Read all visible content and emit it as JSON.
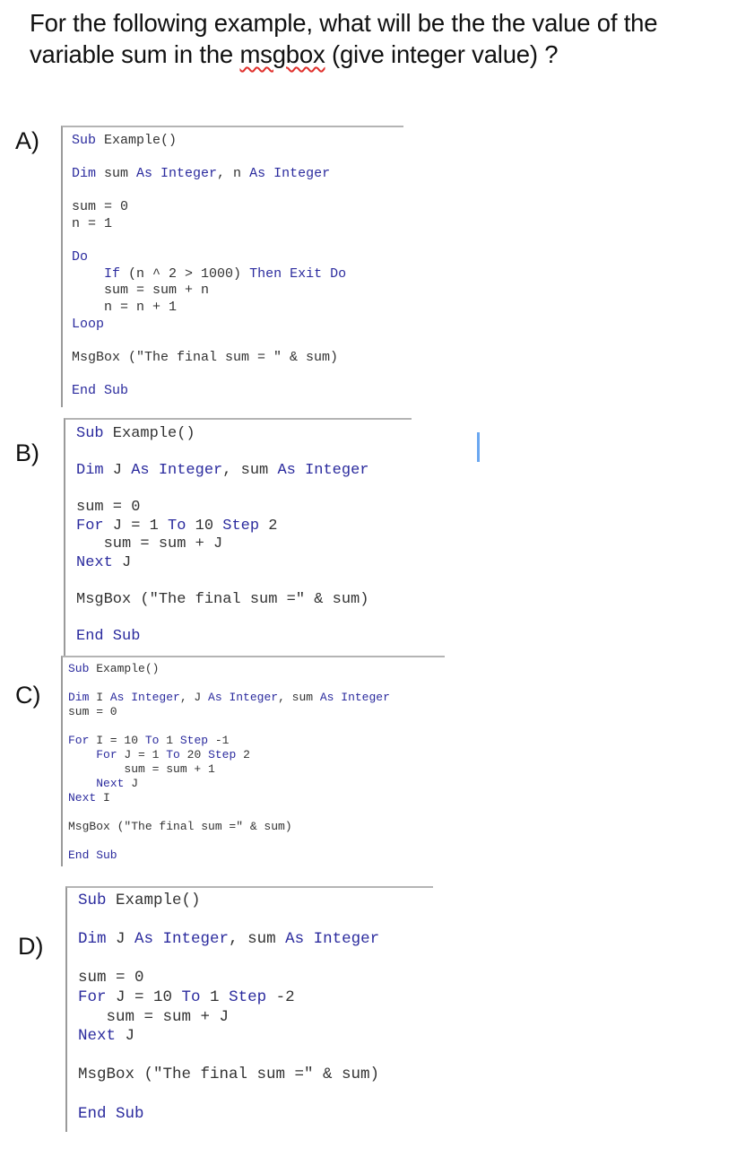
{
  "question": {
    "before": "For the following example, what will be the the value of the variable sum in the ",
    "misspelled": "msgbox",
    "after": " (give integer value) ?"
  },
  "options": [
    {
      "label": "A)",
      "lines": [
        [
          {
            "t": "Sub",
            "k": 1
          },
          {
            "t": " Example()"
          }
        ],
        [
          {
            "t": ""
          }
        ],
        [
          {
            "t": "Dim",
            "k": 1
          },
          {
            "t": " sum "
          },
          {
            "t": "As Integer",
            "k": 1
          },
          {
            "t": ", n "
          },
          {
            "t": "As Integer",
            "k": 1
          }
        ],
        [
          {
            "t": ""
          }
        ],
        [
          {
            "t": "sum = 0"
          }
        ],
        [
          {
            "t": "n = 1"
          }
        ],
        [
          {
            "t": ""
          }
        ],
        [
          {
            "t": "Do",
            "k": 1
          }
        ],
        [
          {
            "t": "    "
          },
          {
            "t": "If",
            "k": 1
          },
          {
            "t": " (n ^ 2 > 1000) "
          },
          {
            "t": "Then Exit Do",
            "k": 1
          }
        ],
        [
          {
            "t": "    sum = sum + n"
          }
        ],
        [
          {
            "t": "    n = n + 1"
          }
        ],
        [
          {
            "t": "Loop",
            "k": 1
          }
        ],
        [
          {
            "t": ""
          }
        ],
        [
          {
            "t": "MsgBox (\"The final sum = \" & sum)"
          }
        ],
        [
          {
            "t": ""
          }
        ],
        [
          {
            "t": "End Sub",
            "k": 1
          }
        ]
      ]
    },
    {
      "label": "B)",
      "lines": [
        [
          {
            "t": "Sub",
            "k": 1
          },
          {
            "t": " Example()"
          }
        ],
        [
          {
            "t": ""
          }
        ],
        [
          {
            "t": "Dim",
            "k": 1
          },
          {
            "t": " J "
          },
          {
            "t": "As Integer",
            "k": 1
          },
          {
            "t": ", sum "
          },
          {
            "t": "As Integer",
            "k": 1
          }
        ],
        [
          {
            "t": ""
          }
        ],
        [
          {
            "t": "sum = 0"
          }
        ],
        [
          {
            "t": "For",
            "k": 1
          },
          {
            "t": " J = 1 "
          },
          {
            "t": "To",
            "k": 1
          },
          {
            "t": " 10 "
          },
          {
            "t": "Step",
            "k": 1
          },
          {
            "t": " 2"
          }
        ],
        [
          {
            "t": "   sum = sum + J"
          }
        ],
        [
          {
            "t": "Next",
            "k": 1
          },
          {
            "t": " J"
          }
        ],
        [
          {
            "t": ""
          }
        ],
        [
          {
            "t": "MsgBox (\"The final sum =\" & sum)"
          }
        ],
        [
          {
            "t": ""
          }
        ],
        [
          {
            "t": "End Sub",
            "k": 1
          }
        ]
      ]
    },
    {
      "label": "C)",
      "lines": [
        [
          {
            "t": "Sub",
            "k": 1
          },
          {
            "t": " Example()"
          }
        ],
        [
          {
            "t": ""
          }
        ],
        [
          {
            "t": "Dim",
            "k": 1
          },
          {
            "t": " I "
          },
          {
            "t": "As Integer",
            "k": 1
          },
          {
            "t": ", J "
          },
          {
            "t": "As Integer",
            "k": 1
          },
          {
            "t": ", sum "
          },
          {
            "t": "As Integer",
            "k": 1
          }
        ],
        [
          {
            "t": "sum = 0"
          }
        ],
        [
          {
            "t": ""
          }
        ],
        [
          {
            "t": "For",
            "k": 1
          },
          {
            "t": " I = 10 "
          },
          {
            "t": "To",
            "k": 1
          },
          {
            "t": " 1 "
          },
          {
            "t": "Step",
            "k": 1
          },
          {
            "t": " -1"
          }
        ],
        [
          {
            "t": "    "
          },
          {
            "t": "For",
            "k": 1
          },
          {
            "t": " J = 1 "
          },
          {
            "t": "To",
            "k": 1
          },
          {
            "t": " 20 "
          },
          {
            "t": "Step",
            "k": 1
          },
          {
            "t": " 2"
          }
        ],
        [
          {
            "t": "        sum = sum + 1"
          }
        ],
        [
          {
            "t": "    "
          },
          {
            "t": "Next",
            "k": 1
          },
          {
            "t": " J"
          }
        ],
        [
          {
            "t": "Next",
            "k": 1
          },
          {
            "t": " I"
          }
        ],
        [
          {
            "t": ""
          }
        ],
        [
          {
            "t": "MsgBox (\"The final sum =\" & sum)"
          }
        ],
        [
          {
            "t": ""
          }
        ],
        [
          {
            "t": "End Sub",
            "k": 1
          }
        ]
      ]
    },
    {
      "label": "D)",
      "lines": [
        [
          {
            "t": "Sub",
            "k": 1
          },
          {
            "t": " Example()"
          }
        ],
        [
          {
            "t": ""
          }
        ],
        [
          {
            "t": "Dim",
            "k": 1
          },
          {
            "t": " J "
          },
          {
            "t": "As Integer",
            "k": 1
          },
          {
            "t": ", sum "
          },
          {
            "t": "As Integer",
            "k": 1
          }
        ],
        [
          {
            "t": ""
          }
        ],
        [
          {
            "t": "sum = 0"
          }
        ],
        [
          {
            "t": "For",
            "k": 1
          },
          {
            "t": " J = 10 "
          },
          {
            "t": "To",
            "k": 1
          },
          {
            "t": " 1 "
          },
          {
            "t": "Step",
            "k": 1
          },
          {
            "t": " -2"
          }
        ],
        [
          {
            "t": "   sum = sum + J"
          }
        ],
        [
          {
            "t": "Next",
            "k": 1
          },
          {
            "t": " J"
          }
        ],
        [
          {
            "t": ""
          }
        ],
        [
          {
            "t": "MsgBox (\"The final sum =\" & sum)"
          }
        ],
        [
          {
            "t": ""
          }
        ],
        [
          {
            "t": "End Sub",
            "k": 1
          }
        ]
      ]
    }
  ],
  "colors": {
    "keyword": "#2b2b9e",
    "code_text": "#333333",
    "cursor": "#6aa7f0"
  }
}
